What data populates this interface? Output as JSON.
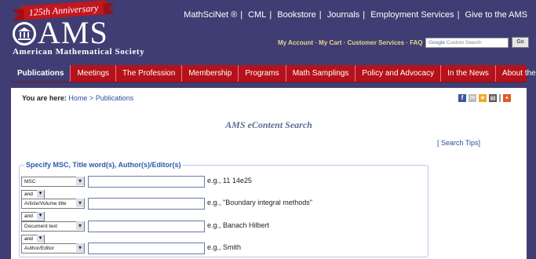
{
  "brand": {
    "anniversary": "125th Anniversary",
    "letters": "AMS",
    "name": "American Mathematical Society"
  },
  "top_links": [
    "MathSciNet ®",
    "CML",
    "Bookstore",
    "Journals",
    "Employment Services",
    "Give to the AMS"
  ],
  "account_links": "My Account · My Cart · Customer Services · FAQ",
  "search": {
    "google": "Google",
    "placeholder": "Custom Search",
    "go": "Go"
  },
  "nav": [
    "Publications",
    "Meetings",
    "The Profession",
    "Membership",
    "Programs",
    "Math Samplings",
    "Policy and Advocacy",
    "In the News",
    "About the AMS"
  ],
  "breadcrumb": {
    "prefix": "You are here:",
    "home": "Home",
    "sep": ">",
    "current": "Publications"
  },
  "share_icons": [
    "facebook-icon",
    "email-icon",
    "bookmark-icon",
    "print-icon",
    "separator",
    "plus-icon"
  ],
  "page_title": "AMS eContent Search",
  "search_tips": "[ Search Tips]",
  "form": {
    "legend": "Specify MSC, Title word(s), Author(s)/Editor(s)",
    "rows": [
      {
        "field": "MSC",
        "value": "",
        "example": "e.g., 11 14e25"
      },
      {
        "field": "Article/Volume title",
        "value": "",
        "example": "e.g., \"Boundary integral methods\""
      },
      {
        "field": "Document text",
        "value": "",
        "example": "e.g., Banach Hilbert"
      },
      {
        "field": "Author/Editor",
        "value": "",
        "example": "e.g., Smith"
      }
    ],
    "connector": "and"
  },
  "colors": {
    "background": "#3f3d73",
    "nav_red": "#b5121b",
    "link": "#2a4f9a",
    "gold": "#e9d48a"
  }
}
